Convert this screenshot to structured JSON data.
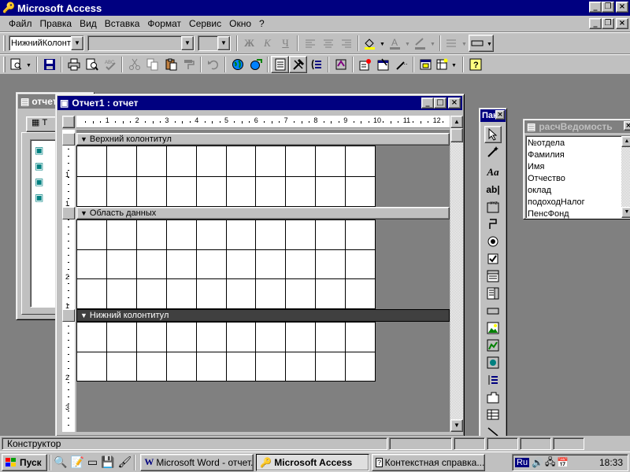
{
  "app": {
    "title": "Microsoft Access"
  },
  "menu": [
    "Файл",
    "Правка",
    "Вид",
    "Вставка",
    "Формат",
    "Сервис",
    "Окно",
    "?"
  ],
  "toolbar": {
    "object_combo": "НижнийКолонт",
    "font_combo": "",
    "size_combo": "",
    "bold": "Ж",
    "italic": "К",
    "underline": "Ч"
  },
  "db_window": {
    "title": "отчет",
    "tab_label": "Т"
  },
  "report_window": {
    "title": "Отчет1 : отчет",
    "ruler_numbers": [
      "1",
      "2",
      "3",
      "4",
      "5",
      "6",
      "7",
      "8",
      "9",
      "10",
      "11",
      "12"
    ],
    "vruler_labels": [
      "1",
      "1",
      "2",
      "1",
      "2",
      "3"
    ],
    "sections": [
      {
        "label": "Верхний колонтитул"
      },
      {
        "label": "Область данных"
      },
      {
        "label": "Нижний колонтитул"
      }
    ]
  },
  "toolbox": {
    "title": "Пан"
  },
  "fieldlist": {
    "title": "расчВедомость",
    "fields": [
      "№отдела",
      "Фамилия",
      "Имя",
      "Отчество",
      "оклад",
      "подоходНалог",
      "ПенсФонд"
    ]
  },
  "status": {
    "text": "Конструктор"
  },
  "taskbar": {
    "start": "Пуск",
    "tasks": [
      {
        "label": "Microsoft Word - отчет..."
      },
      {
        "label": "Microsoft Access"
      },
      {
        "label": "Контекстная справка..."
      }
    ],
    "lang": "Ru",
    "clock": "18:33"
  }
}
